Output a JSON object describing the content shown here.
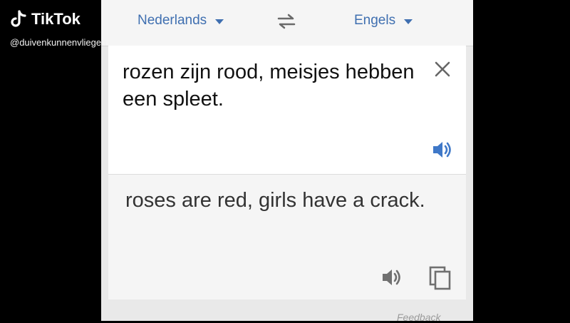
{
  "translator": {
    "source_language": "Nederlands",
    "target_language": "Engels",
    "input_text": "rozen zijn rood, meisjes hebben een spleet.",
    "output_text": "roses are red, girls have a crack.",
    "feedback_label": "Feedback"
  },
  "overlay": {
    "brand": "TikTok",
    "username": "@duivenkunnenvliegen"
  },
  "icons": {
    "caret": "caret-down-icon",
    "swap": "swap-arrows-icon",
    "clear": "close-icon",
    "speaker": "speaker-icon",
    "copy": "copy-icon",
    "tiktok": "tiktok-note-icon"
  },
  "colors": {
    "accent": "#3f6fb0",
    "speaker_blue": "#3f78c8",
    "background": "#000000"
  }
}
